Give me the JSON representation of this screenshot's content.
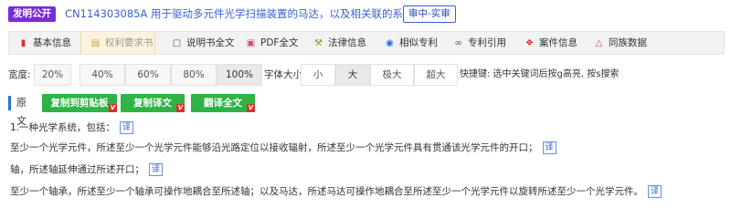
{
  "header": {
    "badge_public": "发明公开",
    "title": "CN114303085A 用于驱动多元件光学扫描装置的马达，以及相关联的系统和方法",
    "badge_status": "审中-实审"
  },
  "tabs": [
    {
      "label": "基本信息",
      "icon": "bookmark-icon",
      "color": "#d9322b"
    },
    {
      "label": "权利要求书",
      "icon": "document-icon",
      "color": "#c7a04a"
    },
    {
      "label": "说明书全文",
      "icon": "document-icon",
      "color": "#555555"
    },
    {
      "label": "PDF全文",
      "icon": "pdf-icon",
      "color": "#c94a7b"
    },
    {
      "label": "法律信息",
      "icon": "gavel-icon",
      "color": "#8a9a1a"
    },
    {
      "label": "相似专利",
      "icon": "eye-icon",
      "color": "#2b6fd6"
    },
    {
      "label": "专利引用",
      "icon": "link-icon",
      "color": "#555555"
    },
    {
      "label": "案件信息",
      "icon": "hammer-icon",
      "color": "#d9322b"
    },
    {
      "label": "同族数据",
      "icon": "family-icon",
      "color": "#c94a7b"
    }
  ],
  "width_control": {
    "label": "宽度:",
    "options": [
      "20%",
      "40%",
      "60%",
      "80%",
      "100%"
    ],
    "selected": "100%"
  },
  "font_control": {
    "label": "字体大小:",
    "options": [
      "小",
      "大",
      "极大",
      "超大"
    ],
    "selected": "大"
  },
  "shortcut_hint": "快捷键: 选中关键词后按g高亮, 按s搜索",
  "toolbar": {
    "original_label": "原文",
    "buttons": [
      {
        "label": "复制到剪贴板",
        "tag": "V"
      },
      {
        "label": "复制译文",
        "tag": "V"
      },
      {
        "label": "翻译全文",
        "tag": "V"
      }
    ]
  },
  "claims": [
    "1.一种光学系统，包括：",
    "至少一个光学元件，所述至少一个光学元件能够沿光路定位以接收辐射，所述至少一个光学元件具有贯通该光学元件的开口；",
    "轴，所述轴延伸通过所述开口；",
    "至少一个轴承，所述至少一个轴承可操作地耦合至所述轴；以及马达，所述马达可操作地耦合至所述至少一个光学元件以旋转所述至少一个光学元件。"
  ],
  "translate_icon_label": "译",
  "colors": {
    "accent": "#3a5fd0",
    "badge_public": "#7a2bd8",
    "green_button": "#2fb344",
    "red_tag": "#d9322b",
    "active_tab": "#fbf3dd"
  }
}
